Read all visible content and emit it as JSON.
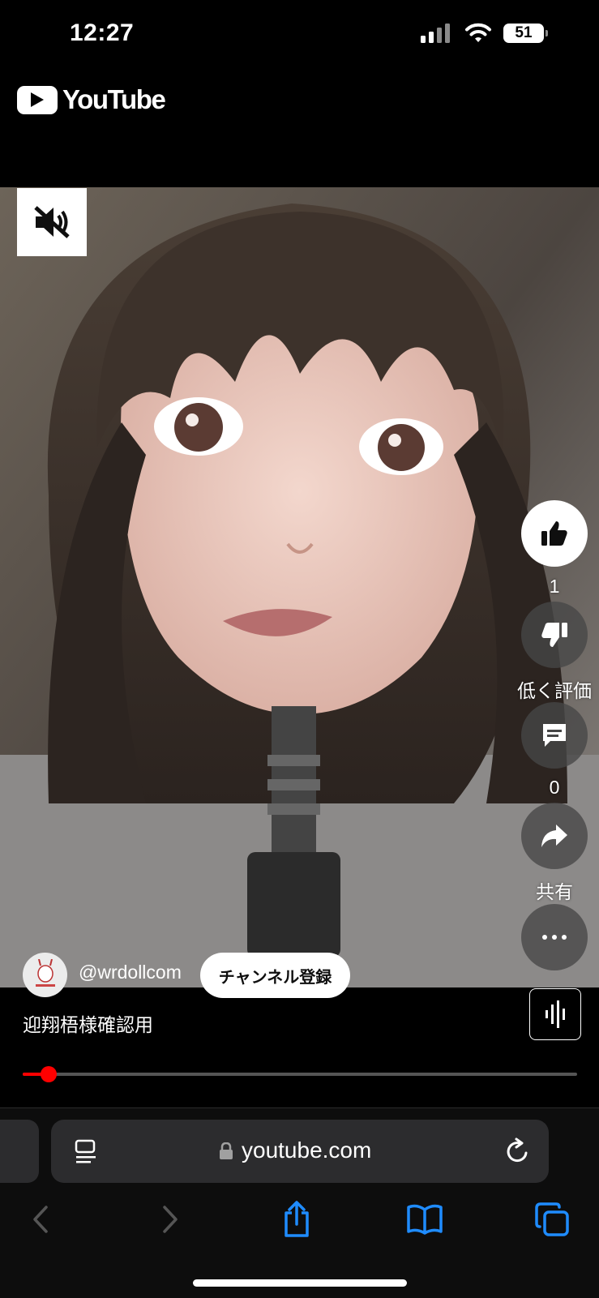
{
  "status_bar": {
    "time": "12:27",
    "battery": "51"
  },
  "header": {
    "logo_text": "YouTube"
  },
  "actions": {
    "like_count": "1",
    "dislike_label": "低く評価",
    "comment_count": "0",
    "share_label": "共有"
  },
  "channel": {
    "handle": "@wrdollcom",
    "subscribe_label": "チャンネル登録"
  },
  "video": {
    "title": "迎翔梧様確認用",
    "progress": 0.047
  },
  "browser": {
    "url": "youtube.com"
  },
  "icons": [
    "mute-icon",
    "like-icon",
    "dislike-icon",
    "comment-icon",
    "share-icon",
    "more-icon",
    "sound-wave-icon",
    "reader-icon",
    "lock-icon",
    "reload-icon",
    "back-icon",
    "forward-icon",
    "share-sheet-icon",
    "bookmarks-icon",
    "tabs-icon"
  ],
  "colors": {
    "accent": "#ff0000",
    "background": "#000000"
  }
}
